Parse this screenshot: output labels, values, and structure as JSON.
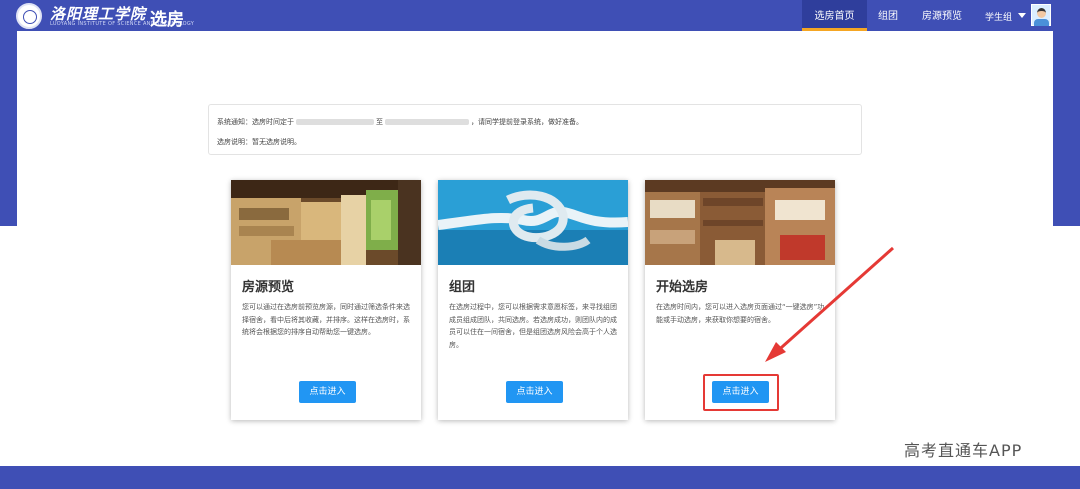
{
  "header": {
    "school_name": "洛阳理工学院",
    "school_subtitle": "LUOYANG INSTITUTE OF SCIENCE AND TECHNOLOGY",
    "app_name": "选房",
    "nav": [
      {
        "label": "选房首页",
        "active": true
      },
      {
        "label": "组团",
        "active": false
      },
      {
        "label": "房源预览",
        "active": false
      }
    ],
    "user_name": "学生组",
    "accent": "#3f4fb5",
    "active_underline": "#f5a623"
  },
  "notice": {
    "line1_prefix": "系统通知：选房时间定于",
    "line1_mid": "至",
    "line1_suffix": "，请同学提前登录系统，做好准备。",
    "line2": "选房说明：暂无选房说明。"
  },
  "cards": [
    {
      "title": "房源预览",
      "description": "您可以通过在选房前预览房源，同时通过筛选条件来选择宿舍，看中后将其收藏，并排序。这样在选房时，系统将会根据您的排序自动帮助您一键选房。",
      "button": "点击进入",
      "image": "dorm-room-photo"
    },
    {
      "title": "组团",
      "description": "在选房过程中，您可以根据需求意愿标签，来寻找组团成员组成团队，共同选房。若选房成功，则团队内的成员可以住在一间宿舍，但是组团选房风险会高于个人选房。",
      "button": "点击进入",
      "image": "rope-knot-photo"
    },
    {
      "title": "开始选房",
      "description": "在选房时间内，您可以进入选房页面通过“一键选房”功能或手动选房，来获取你想要的宿舍。",
      "button": "点击进入",
      "image": "bunk-bed-room-photo"
    }
  ],
  "annotation": {
    "color": "#e53935"
  },
  "button_color": "#2196f3",
  "watermark": "高考直通车APP"
}
